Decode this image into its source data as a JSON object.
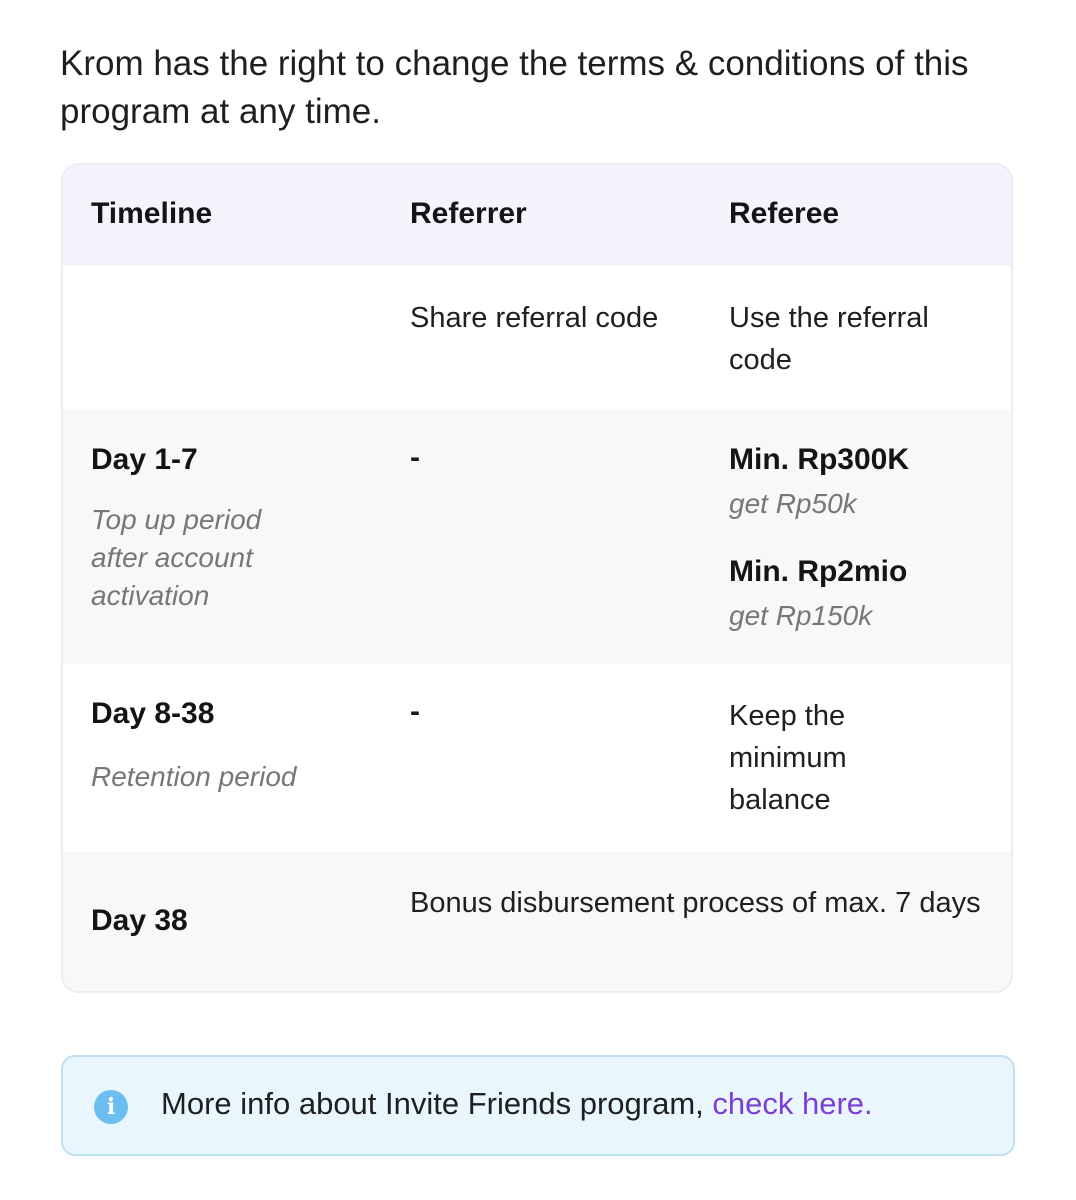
{
  "intro": "Krom has the right to change the terms & conditions of this program at any time.",
  "table": {
    "headers": [
      "Timeline",
      "Referrer",
      "Referee"
    ],
    "rows": [
      {
        "timeline_title": "",
        "timeline_note": "",
        "referrer": "Share referral code",
        "referee": "Use the referral code"
      },
      {
        "timeline_title": "Day 1-7",
        "timeline_note": "Top up period after account activation",
        "referrer": "-",
        "referee_tiers": [
          {
            "min": "Min. Rp300K",
            "get": "get Rp50k"
          },
          {
            "min": "Min. Rp2mio",
            "get": "get Rp150k"
          }
        ]
      },
      {
        "timeline_title": "Day 8-38",
        "timeline_note": "Retention period",
        "referrer": "-",
        "referee": "Keep the minimum balance"
      },
      {
        "timeline_title": "Day 38",
        "combined": "Bonus disbursement process of max. 7 days"
      }
    ]
  },
  "info": {
    "icon": "info-icon",
    "text": "More info about Invite Friends program, ",
    "link_text": "check here."
  },
  "colors": {
    "header_bg": "#f5f3fc",
    "alt_row_bg": "#f8f8f8",
    "info_bg": "#eaf6fd",
    "info_border": "#bfe0f2",
    "link": "#7b3fd6",
    "muted_text": "#777777"
  }
}
